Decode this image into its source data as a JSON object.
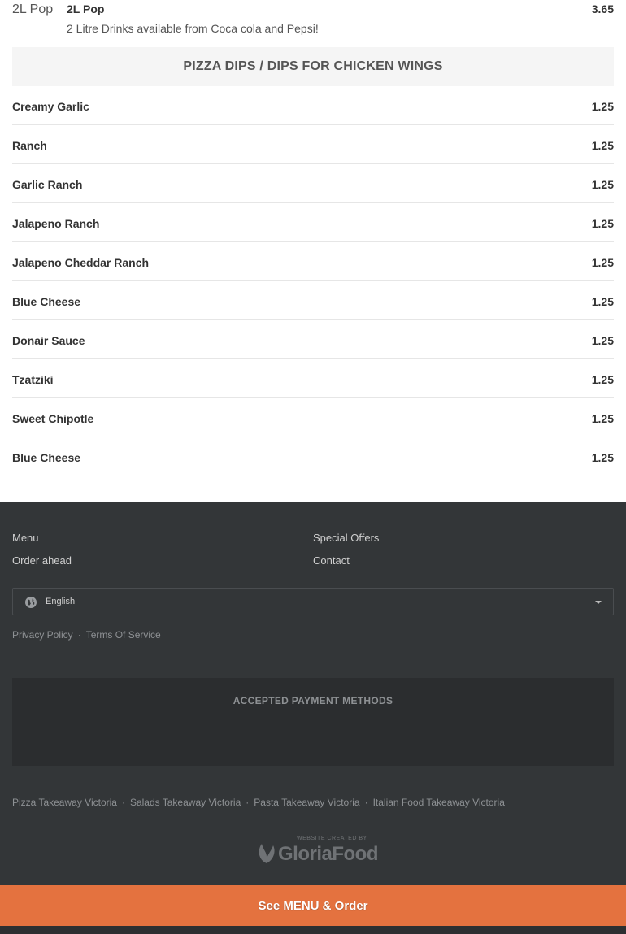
{
  "top_item": {
    "image_alt": "2L Pop",
    "name": "2L Pop",
    "description": "2 Litre Drinks available from Coca cola and Pepsi!",
    "price": "3.65"
  },
  "category": {
    "title": "PIZZA DIPS / DIPS FOR CHICKEN WINGS",
    "items": [
      {
        "name": "Creamy Garlic",
        "price": "1.25"
      },
      {
        "name": "Ranch",
        "price": "1.25"
      },
      {
        "name": "Garlic Ranch",
        "price": "1.25"
      },
      {
        "name": "Jalapeno Ranch",
        "price": "1.25"
      },
      {
        "name": "Jalapeno Cheddar Ranch",
        "price": "1.25"
      },
      {
        "name": "Blue Cheese",
        "price": "1.25"
      },
      {
        "name": "Donair Sauce",
        "price": "1.25"
      },
      {
        "name": "Tzatziki",
        "price": "1.25"
      },
      {
        "name": "Sweet Chipotle",
        "price": "1.25"
      },
      {
        "name": "Blue Cheese",
        "price": "1.25"
      }
    ]
  },
  "footer": {
    "nav": {
      "menu": "Menu",
      "order_ahead": "Order ahead",
      "special_offers": "Special Offers",
      "contact": "Contact"
    },
    "language": {
      "selected": "English",
      "icon": "globe-icon"
    },
    "legal": {
      "privacy": "Privacy Policy",
      "terms": "Terms Of Service"
    },
    "payment_title": "ACCEPTED PAYMENT METHODS",
    "seo_links": [
      "Pizza Takeaway Victoria",
      "Salads Takeaway Victoria",
      "Pasta Takeaway Victoria",
      "Italian Food Takeaway Victoria"
    ],
    "logo": {
      "small": "WEBSITE CREATED BY",
      "big": "GloriaFood"
    }
  },
  "cta": {
    "label": "See MENU & Order"
  },
  "colors": {
    "accent": "#e4723f",
    "footer_bg": "#333638",
    "header_bg": "#f5f5f5"
  }
}
